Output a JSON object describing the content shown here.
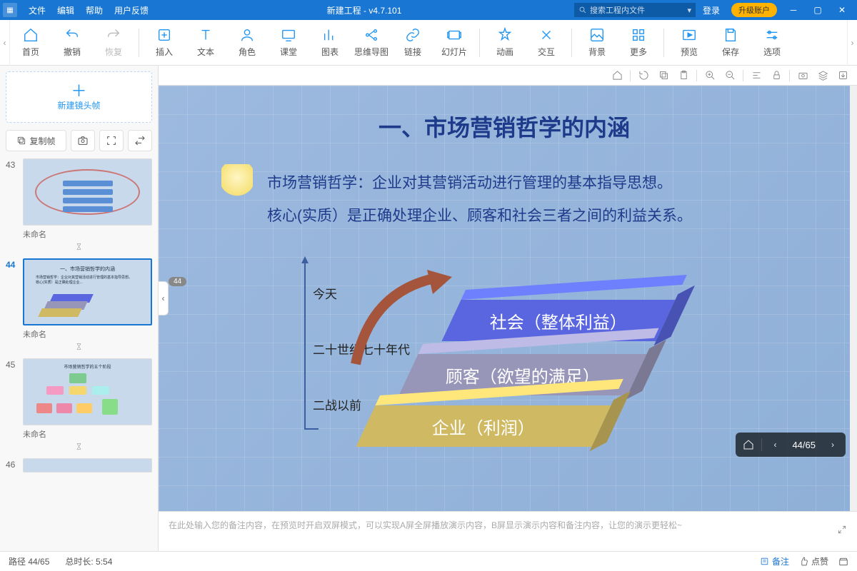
{
  "titlebar": {
    "menus": [
      "文件",
      "编辑",
      "帮助",
      "用户反馈"
    ],
    "title": "新建工程 - v4.7.101",
    "search_placeholder": "搜索工程内文件",
    "login": "登录",
    "upgrade": "升级账户"
  },
  "toolbar": {
    "home": "首页",
    "undo": "撤销",
    "redo": "恢复",
    "insert": "插入",
    "text": "文本",
    "role": "角色",
    "class": "课堂",
    "chart": "图表",
    "mind": "思维导图",
    "link": "链接",
    "slide": "幻灯片",
    "anim": "动画",
    "inter": "交互",
    "bg": "背景",
    "more": "更多",
    "preview": "预览",
    "save": "保存",
    "opt": "选项"
  },
  "sidebar": {
    "new_frame": "新建镜头帧",
    "copy": "复制帧",
    "thumbs": [
      {
        "n": "43",
        "title": "未命名"
      },
      {
        "n": "44",
        "title": "未命名"
      },
      {
        "n": "45",
        "title": "未命名"
      },
      {
        "n": "46",
        "title": ""
      }
    ]
  },
  "slide": {
    "badge": "44",
    "title": "一、市场营销哲学的内涵",
    "p1": "市场营销哲学：企业对其营销活动进行管理的基本指导思想。",
    "p2": "核心(实质）是正确处理企业、顾客和社会三者之间的利益关系。",
    "axis": [
      "今天",
      "二十世纪七十年代",
      "二战以前"
    ],
    "layers": [
      "社会（整体利益）",
      "顾客（欲望的满足）",
      "企业（利润）"
    ]
  },
  "pager": {
    "num": "44/65"
  },
  "notes": {
    "placeholder": "在此处输入您的备注内容，在预览时开启双屏模式，可以实现A屏全屏播放演示内容，B屏显示演示内容和备注内容，让您的演示更轻松~"
  },
  "status": {
    "path": "路径 44/65",
    "duration": "总时长: 5:54",
    "notes": "备注",
    "like": "点赞"
  }
}
